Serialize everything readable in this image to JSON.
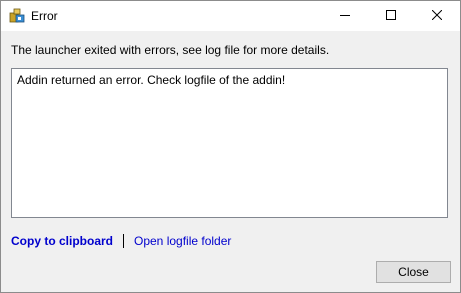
{
  "window": {
    "title": "Error",
    "app_icon": "launcher-app-icon",
    "controls": {
      "minimize": "minimize-icon",
      "maximize": "maximize-icon",
      "close": "close-icon"
    }
  },
  "message": "The launcher exited with errors, see log file for more details.",
  "log_text": "Addin returned an error. Check logfile of the addin!",
  "links": {
    "copy_label": "Copy to clipboard",
    "open_folder_label": "Open logfile folder",
    "link_color": "#0000cd"
  },
  "close_button_label": "Close"
}
